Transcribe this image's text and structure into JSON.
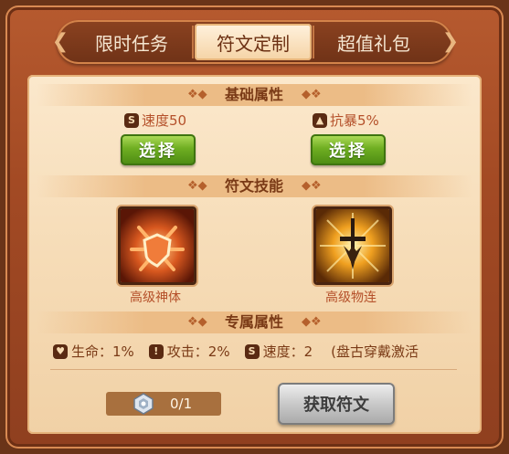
{
  "tabs": [
    {
      "label": "限时任务",
      "active": false
    },
    {
      "label": "符文定制",
      "active": true
    },
    {
      "label": "超值礼包",
      "active": false
    }
  ],
  "basic_section": {
    "title": "基础属性",
    "attrs": [
      {
        "icon": "speed-icon",
        "label": "速度50",
        "button": "选择"
      },
      {
        "icon": "crit-icon",
        "label": "抗暴5%",
        "button": "选择"
      }
    ]
  },
  "skill_section": {
    "title": "符文技能",
    "skills": [
      {
        "icon": "divine-body-icon",
        "name": "高级神体"
      },
      {
        "icon": "combo-strike-icon",
        "name": "高级物连"
      }
    ]
  },
  "exclusive_section": {
    "title": "专属属性",
    "items": [
      {
        "icon": "heart-icon",
        "text": "生命：1%"
      },
      {
        "icon": "attack-icon",
        "text": "攻击：2%"
      },
      {
        "icon": "speed-icon",
        "text": "速度：2"
      }
    ],
    "note": "(盘古穿戴激活"
  },
  "footer": {
    "counter": "0/1",
    "get_button": "获取符文"
  },
  "colors": {
    "frame": "#a34a24",
    "panel": "#f6dcb7",
    "accent_text": "#b5502a",
    "green_button": "#6fae22",
    "gray_button": "#c9c9c9"
  }
}
